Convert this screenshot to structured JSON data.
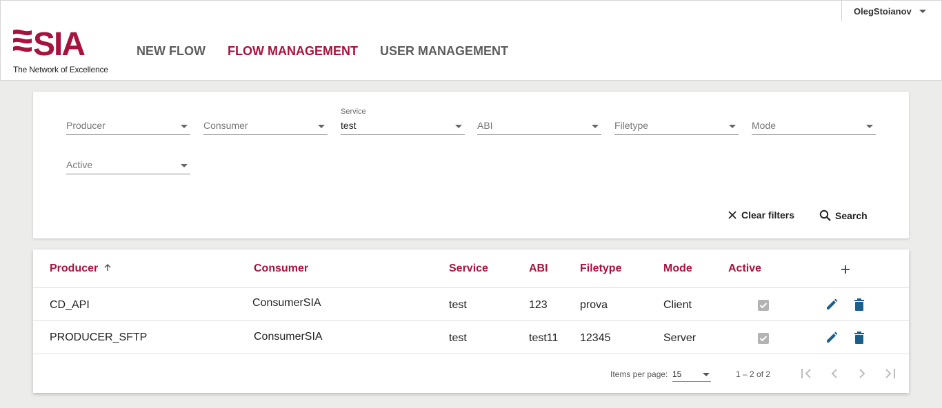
{
  "user": {
    "name": "OlegStoianov"
  },
  "brand": {
    "logo_text": "SIA",
    "tagline": "The Network of Excellence",
    "accent": "#a8123e"
  },
  "nav": {
    "items": [
      {
        "label": "NEW FLOW",
        "active": false
      },
      {
        "label": "FLOW MANAGEMENT",
        "active": true
      },
      {
        "label": "USER MANAGEMENT",
        "active": false
      }
    ]
  },
  "filters": {
    "producer": {
      "placeholder": "Producer",
      "value": ""
    },
    "consumer": {
      "placeholder": "Consumer",
      "value": ""
    },
    "service": {
      "label": "Service",
      "value": "test"
    },
    "abi": {
      "placeholder": "ABI",
      "value": ""
    },
    "filetype": {
      "placeholder": "Filetype",
      "value": ""
    },
    "mode": {
      "placeholder": "Mode",
      "value": ""
    },
    "active": {
      "placeholder": "Active",
      "value": ""
    },
    "clear_label": "Clear filters",
    "search_label": "Search"
  },
  "table": {
    "columns": [
      "Producer",
      "Consumer",
      "Service",
      "ABI",
      "Filetype",
      "Mode",
      "Active"
    ],
    "sort": {
      "column": "Producer",
      "direction": "asc"
    },
    "rows": [
      {
        "producer": "CD_API",
        "consumer": "ConsumerSIA",
        "service": "test",
        "abi": "123",
        "filetype": "prova",
        "mode": "Client",
        "active": true
      },
      {
        "producer": "PRODUCER_SFTP",
        "consumer": "ConsumerSIA",
        "service": "test",
        "abi": "test11",
        "filetype": "12345",
        "mode": "Server",
        "active": true
      }
    ]
  },
  "paginator": {
    "items_per_page_label": "Items per page:",
    "items_per_page": "15",
    "range_label": "1 – 2 of 2"
  },
  "icons": {
    "add": "plus-icon",
    "edit": "pencil-icon",
    "delete": "trash-icon",
    "clear": "close-icon",
    "search": "search-icon",
    "first": "first-page-icon",
    "prev": "chevron-left-icon",
    "next": "chevron-right-icon",
    "last": "last-page-icon"
  },
  "colors": {
    "accent": "#a8123e",
    "icon_blue": "#1a5f8a",
    "checkbox_disabled": "#b3b3b3"
  }
}
